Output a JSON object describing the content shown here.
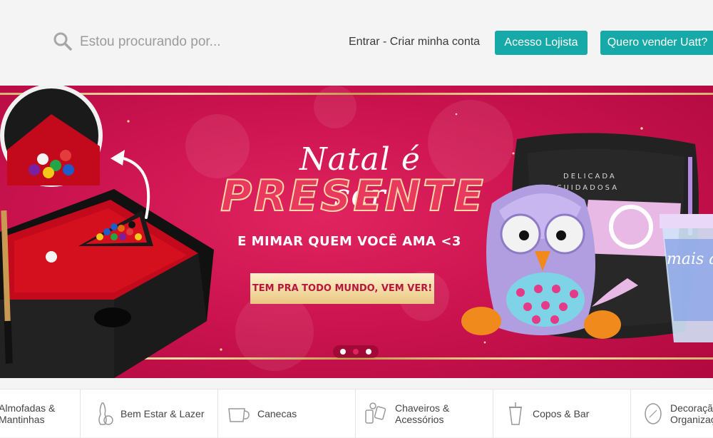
{
  "header": {
    "search_placeholder": "Estou procurando por...",
    "login_link": "Entrar - Criar minha conta",
    "retailer_button": "Acesso Lojista",
    "seller_button": "Quero vender Uatt?"
  },
  "banner": {
    "title_script": "Natal é ser",
    "title_main": "PRESENTE",
    "subtitle": "E MIMAR QUEM VOCÊ AMA <3",
    "cta": "TEM PRA TODO MUNDO, VEM VER!",
    "slides": 3,
    "active_slide": 2,
    "product_texts": {
      "cushion_tag_1": "DELICADA",
      "cushion_tag_2": "E CUIDADOSA",
      "cup_text": "mais amor"
    },
    "colors": {
      "background": "#cc1450",
      "gold": "#e9c783",
      "title_fill": "#e9395f"
    }
  },
  "categories": [
    {
      "label": "Almofadas &\nMantinhas",
      "icon": "cushion-icon"
    },
    {
      "label": "Bem Estar & Lazer",
      "icon": "bowling-icon"
    },
    {
      "label": "Canecas",
      "icon": "mug-icon"
    },
    {
      "label": "Chaveiros &\nAcessórios",
      "icon": "keychain-icon"
    },
    {
      "label": "Copos & Bar",
      "icon": "cup-icon"
    },
    {
      "label": "Decoração &\nOrganização",
      "icon": "mirror-icon"
    }
  ],
  "accent_color": "#17a9a7"
}
